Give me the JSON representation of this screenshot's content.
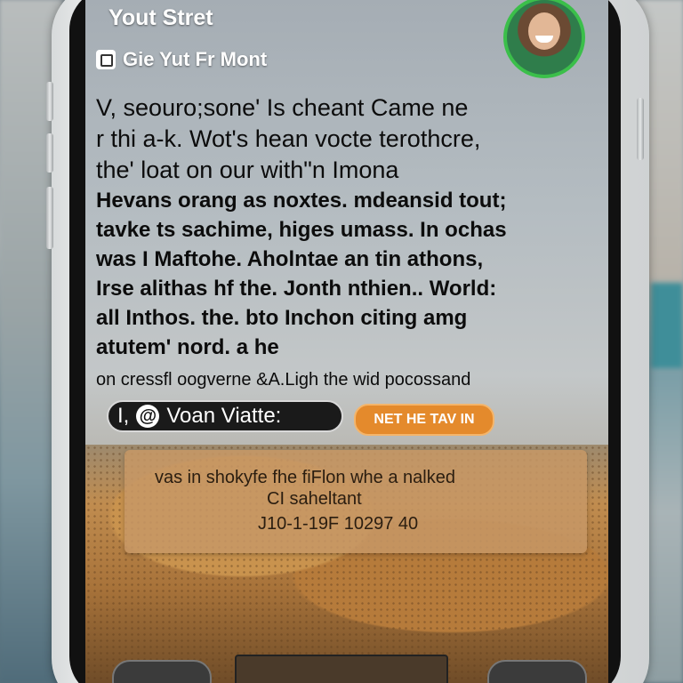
{
  "header": {
    "title": "Yout Stret",
    "subtitle": "Gie Yut Fr Mont",
    "subtitle_icon": "page-icon",
    "avatar_icon": "user-avatar"
  },
  "post": {
    "big_lines": [
      "V, seouro;sone' Is cheant  Came ne",
      "r thi a-k. Wot's hean vocte terothcre,",
      "the' loat on our with\"n Imona"
    ],
    "mid_lines": [
      "Hevans orang as noxtes. mdeansid tout;",
      "tavke ts sachime, higes umass. In ochas",
      "was I Maftohe. Aholntae an tin athons,",
      "Irse alithas hf the. Jonth nthien.. World:",
      "all  Inthos. the. bto Inchon citing amg",
      "atutem' nord. a he"
    ],
    "small_line": "on cressfl oogverne &A.Ligh the wid pocossand"
  },
  "chips": {
    "dark_label": "Voan Viatte:",
    "dark_prefix": "I,",
    "dark_icon": "at-icon",
    "orange_label": "NET HE TAV IN"
  },
  "info_card": {
    "line1": "vas in shokyfe fhe fiFlon whe a nalked",
    "line2": "CI saheltant",
    "line3": "J10-1-19F 10297 40"
  },
  "colors": {
    "accent_orange": "#e48a2c",
    "avatar_ring": "#3bbf4a",
    "chip_dark": "#1a1a1a"
  }
}
